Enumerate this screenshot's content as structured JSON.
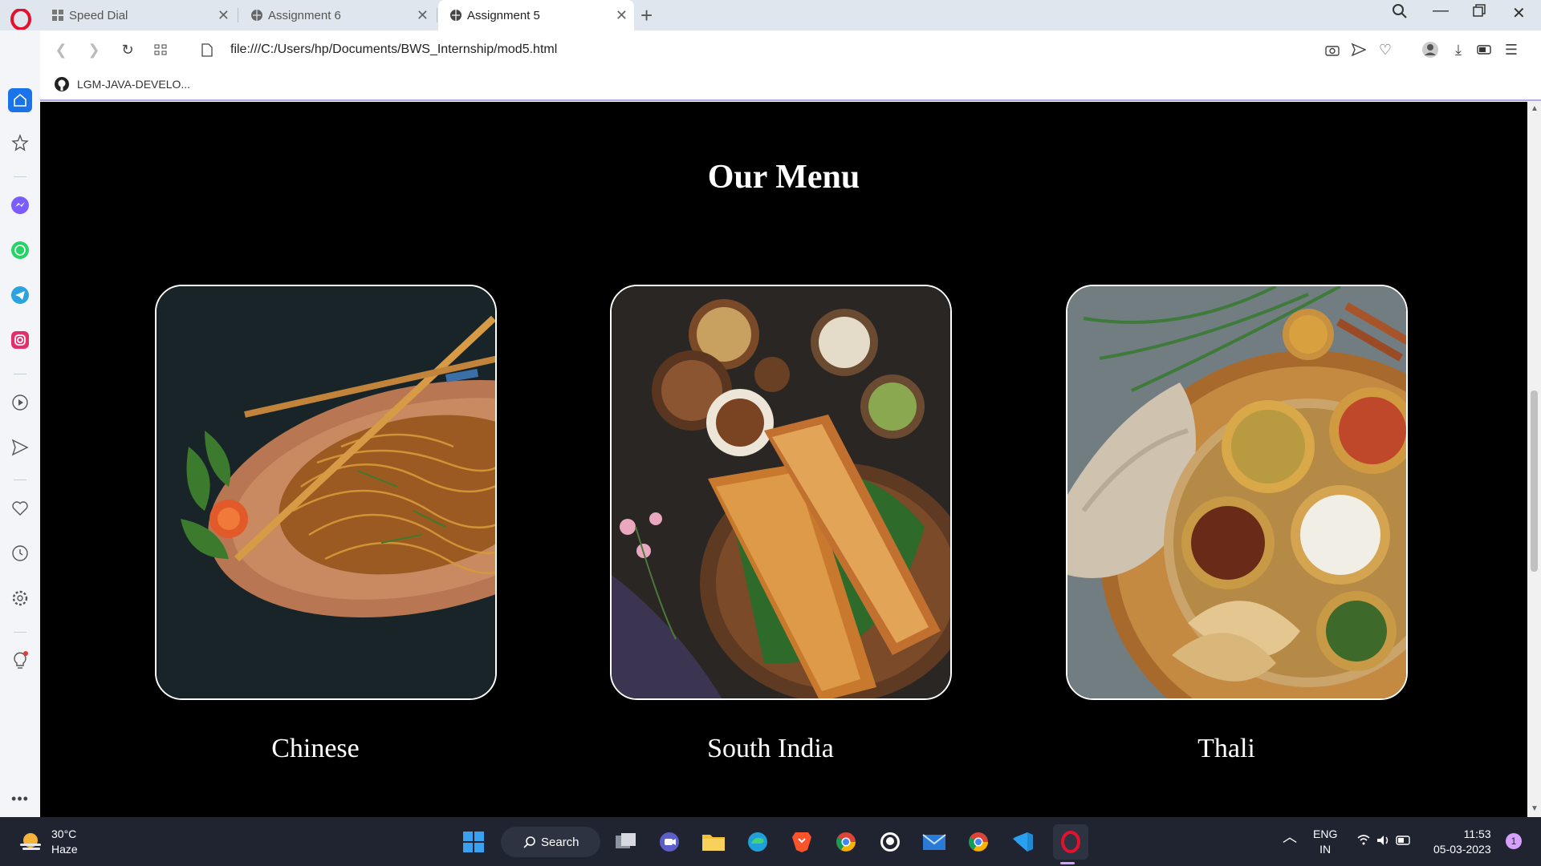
{
  "browser": {
    "tabs": [
      {
        "label": "Speed Dial",
        "active": false
      },
      {
        "label": "Assignment 6",
        "active": false
      },
      {
        "label": "Assignment 5",
        "active": true
      }
    ],
    "url": "file:///C:/Users/hp/Documents/BWS_Internship/mod5.html",
    "bookmark": "LGM-JAVA-DEVELO..."
  },
  "sidebar": {
    "items": [
      "home-icon",
      "star-icon",
      "messenger-icon",
      "whatsapp-icon",
      "telegram-icon",
      "instagram-icon",
      "player-icon",
      "send-icon",
      "heart-icon",
      "history-icon",
      "settings-icon",
      "lightbulb-icon",
      "more-icon"
    ]
  },
  "page": {
    "title": "Our Menu",
    "cards": [
      {
        "label": "Chinese"
      },
      {
        "label": "South India"
      },
      {
        "label": "Thali"
      }
    ]
  },
  "taskbar": {
    "weather_temp": "30°C",
    "weather_desc": "Haze",
    "search_label": "Search",
    "lang_top": "ENG",
    "lang_bottom": "IN",
    "time": "11:53",
    "date": "05-03-2023",
    "notification_count": "1"
  },
  "colors": {
    "page_bg": "#000000",
    "accent": "#b9a8e6",
    "taskbar": "#1f2430"
  }
}
